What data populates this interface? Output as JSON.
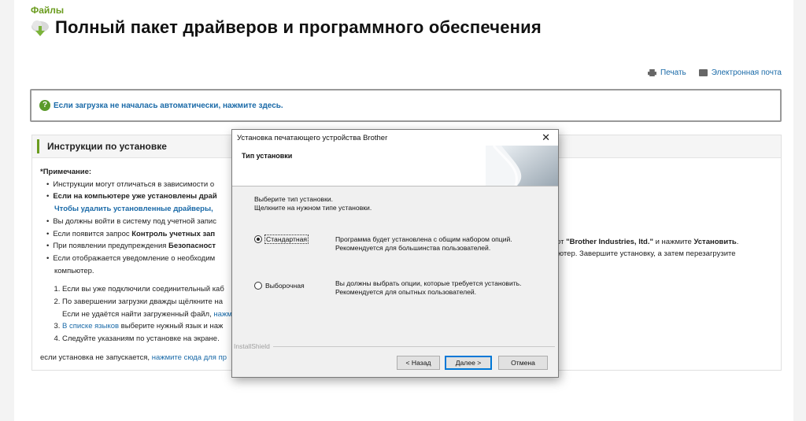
{
  "breadcrumb": "Файлы",
  "title": "Полный пакет драйверов и программного обеспечения",
  "links": {
    "print": "Печать",
    "email": "Электронная почта"
  },
  "notice": "Если загрузка не началась автоматически, нажмите здесь.",
  "instructions": {
    "heading": "Инструкции по установке",
    "note_label": "*Примечание:",
    "bullets": [
      "Инструкции могут отличаться в зависимости о",
      "Если на компьютере уже установлены драй",
      "Чтобы удалить установленные драйверы, ",
      "Вы должны войти в систему под учетной запис",
      "Если появится запрос ",
      "Контроль учетных зап",
      "При появлении предупреждения ",
      "Безопасност",
      "Если отображается уведомление о необходим",
      "компьютер."
    ],
    "steps": [
      "Если вы уже подключили соединительный каб",
      "По завершении загрузки дважды щёлкните на",
      "Если не удаётся найти загруженный файл, ",
      "нажм",
      "В списке языков",
      " выберите нужный язык и наж",
      "Следуйте указаниям по установке на экране."
    ],
    "footer_text": "если установка не запускается, ",
    "footer_link": "нажмите сюда для пр",
    "right_frag1_a": "от ",
    "right_frag1_b": "\"Brother Industries, ltd.\"",
    "right_frag1_c": " и нажмите ",
    "right_frag1_d": "Установить",
    "right_frag1_e": ".",
    "right_frag2": "ютер. Завершите установку, а затем перезагрузите"
  },
  "dialog": {
    "title": "Установка печатающего устройства Brother",
    "header": "Тип установки",
    "prompt_line1": "Выберите тип установки.",
    "prompt_line2": "Щелкните на нужном типе установки.",
    "options": [
      {
        "label": "Стандартная",
        "selected": true,
        "desc1": "Программа будет установлена с общим набором опций.",
        "desc2": "Рекомендуется для большинства пользователей."
      },
      {
        "label": "Выборочная",
        "selected": false,
        "desc1": "Вы должны выбрать опции, которые требуется установить.",
        "desc2": "Рекомендуется для опытных пользователей."
      }
    ],
    "installshield": "InstallShield",
    "buttons": {
      "back": "< Назад",
      "next": "Далее >",
      "cancel": "Отмена"
    }
  }
}
